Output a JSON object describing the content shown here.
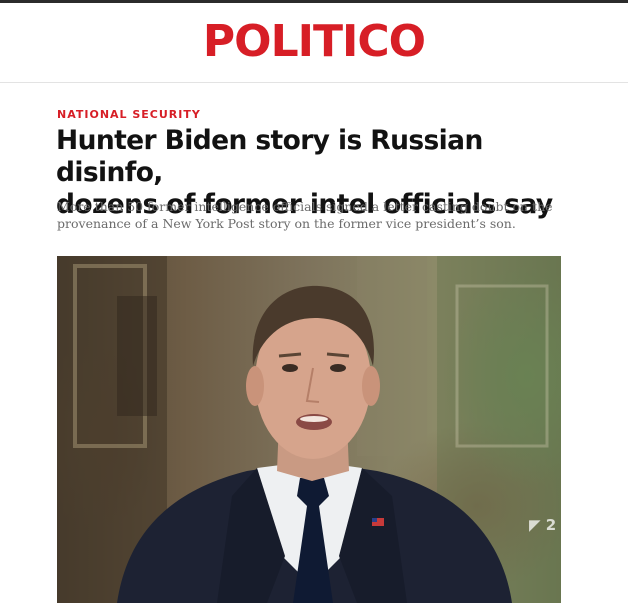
{
  "header": {
    "logo_text": "POLITICO"
  },
  "article": {
    "category": "NATIONAL SECURITY",
    "headline_line1": "Hunter Biden story is Russian disinfo,",
    "headline_line2": "dozens of former intel officials say",
    "dek_line1": "More than 50 former intelligence officials signed a letter casting doubt on the",
    "dek_line2": "provenance of a New York Post story on the former vice president’s son.",
    "image": {
      "description_icon": "portrait-photo",
      "broadcast_bug": "◤ 2"
    }
  },
  "colors": {
    "brand_red": "#d71e26",
    "headline": "#121212",
    "dek": "#6b6b6b"
  }
}
